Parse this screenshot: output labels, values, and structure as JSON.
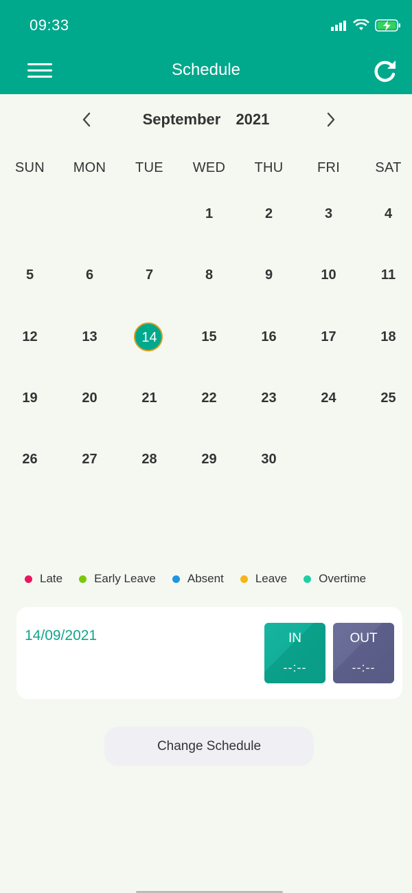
{
  "status_bar": {
    "time": "09:33",
    "icons": [
      "signal-icon",
      "wifi-icon",
      "battery-charging-icon"
    ]
  },
  "header": {
    "title": "Schedule",
    "left_icon": "menu-icon",
    "right_icon": "refresh-icon",
    "background": "#00a88c"
  },
  "calendar": {
    "month": "September",
    "year": "2021",
    "weekdays": [
      "SUN",
      "MON",
      "TUE",
      "WED",
      "THU",
      "FRI",
      "SAT"
    ],
    "weeks": [
      [
        "",
        "",
        "",
        "1",
        "2",
        "3",
        "4"
      ],
      [
        "5",
        "6",
        "7",
        "8",
        "9",
        "10",
        "11"
      ],
      [
        "12",
        "13",
        "14",
        "15",
        "16",
        "17",
        "18"
      ],
      [
        "19",
        "20",
        "21",
        "22",
        "23",
        "24",
        "25"
      ],
      [
        "26",
        "27",
        "28",
        "29",
        "30",
        "",
        ""
      ]
    ],
    "selected_day": "14",
    "selected_color": "#00a88c",
    "selected_ring_color": "#d89c1a"
  },
  "legend": [
    {
      "label": "Late",
      "color": "#e8175d"
    },
    {
      "label": "Early Leave",
      "color": "#7ac70c"
    },
    {
      "label": "Absent",
      "color": "#1d95e0"
    },
    {
      "label": "Leave",
      "color": "#f5b51b"
    },
    {
      "label": "Overtime",
      "color": "#1fcfa3"
    }
  ],
  "attendance": {
    "date": "14/09/2021",
    "in_label": "IN",
    "in_time": "--:--",
    "out_label": "OUT",
    "out_time": "--:--"
  },
  "actions": {
    "change_schedule": "Change Schedule"
  }
}
